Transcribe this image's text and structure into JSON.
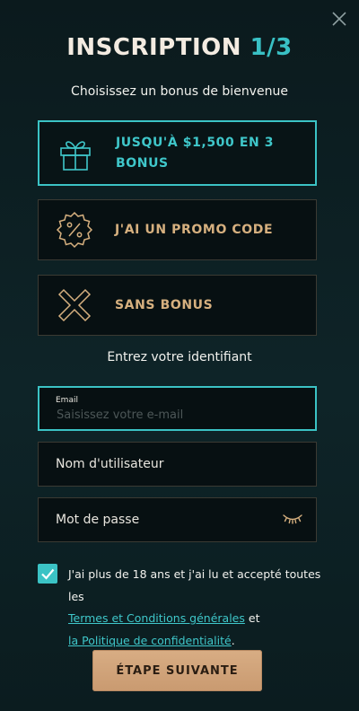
{
  "header": {
    "title": "INSCRIPTION",
    "step": "1/3",
    "subtitle": "Choisissez un bonus de bienvenue"
  },
  "bonus_options": [
    {
      "line1": "JUSQU'À $1,500 EN 3",
      "line2": "BONUS",
      "icon": "gift-icon",
      "selected": true
    },
    {
      "line1": "J'AI UN PROMO CODE",
      "icon": "percent-badge-icon",
      "selected": false
    },
    {
      "line1": "SANS BONUS",
      "icon": "cross-icon",
      "selected": false
    }
  ],
  "identifier": {
    "label": "Entrez votre identifiant",
    "email_label": "Email",
    "email_placeholder": "Saisissez votre e-mail",
    "email_value": "",
    "username_placeholder": "Nom d'utilisateur",
    "password_placeholder": "Mot de passe"
  },
  "consent": {
    "checked": true,
    "text_before": "J'ai plus de 18 ans et j'ai lu et accepté toutes les",
    "terms_link": "Termes et Conditions générales",
    "and": "et",
    "privacy_link": "la Politique de confidentialité",
    "period": "."
  },
  "actions": {
    "next": "ÉTAPE SUIVANTE"
  },
  "colors": {
    "accent": "#3bc3c5",
    "gold": "#d6b07f",
    "button": "#d8ad84",
    "background": "#0b1c1f"
  }
}
